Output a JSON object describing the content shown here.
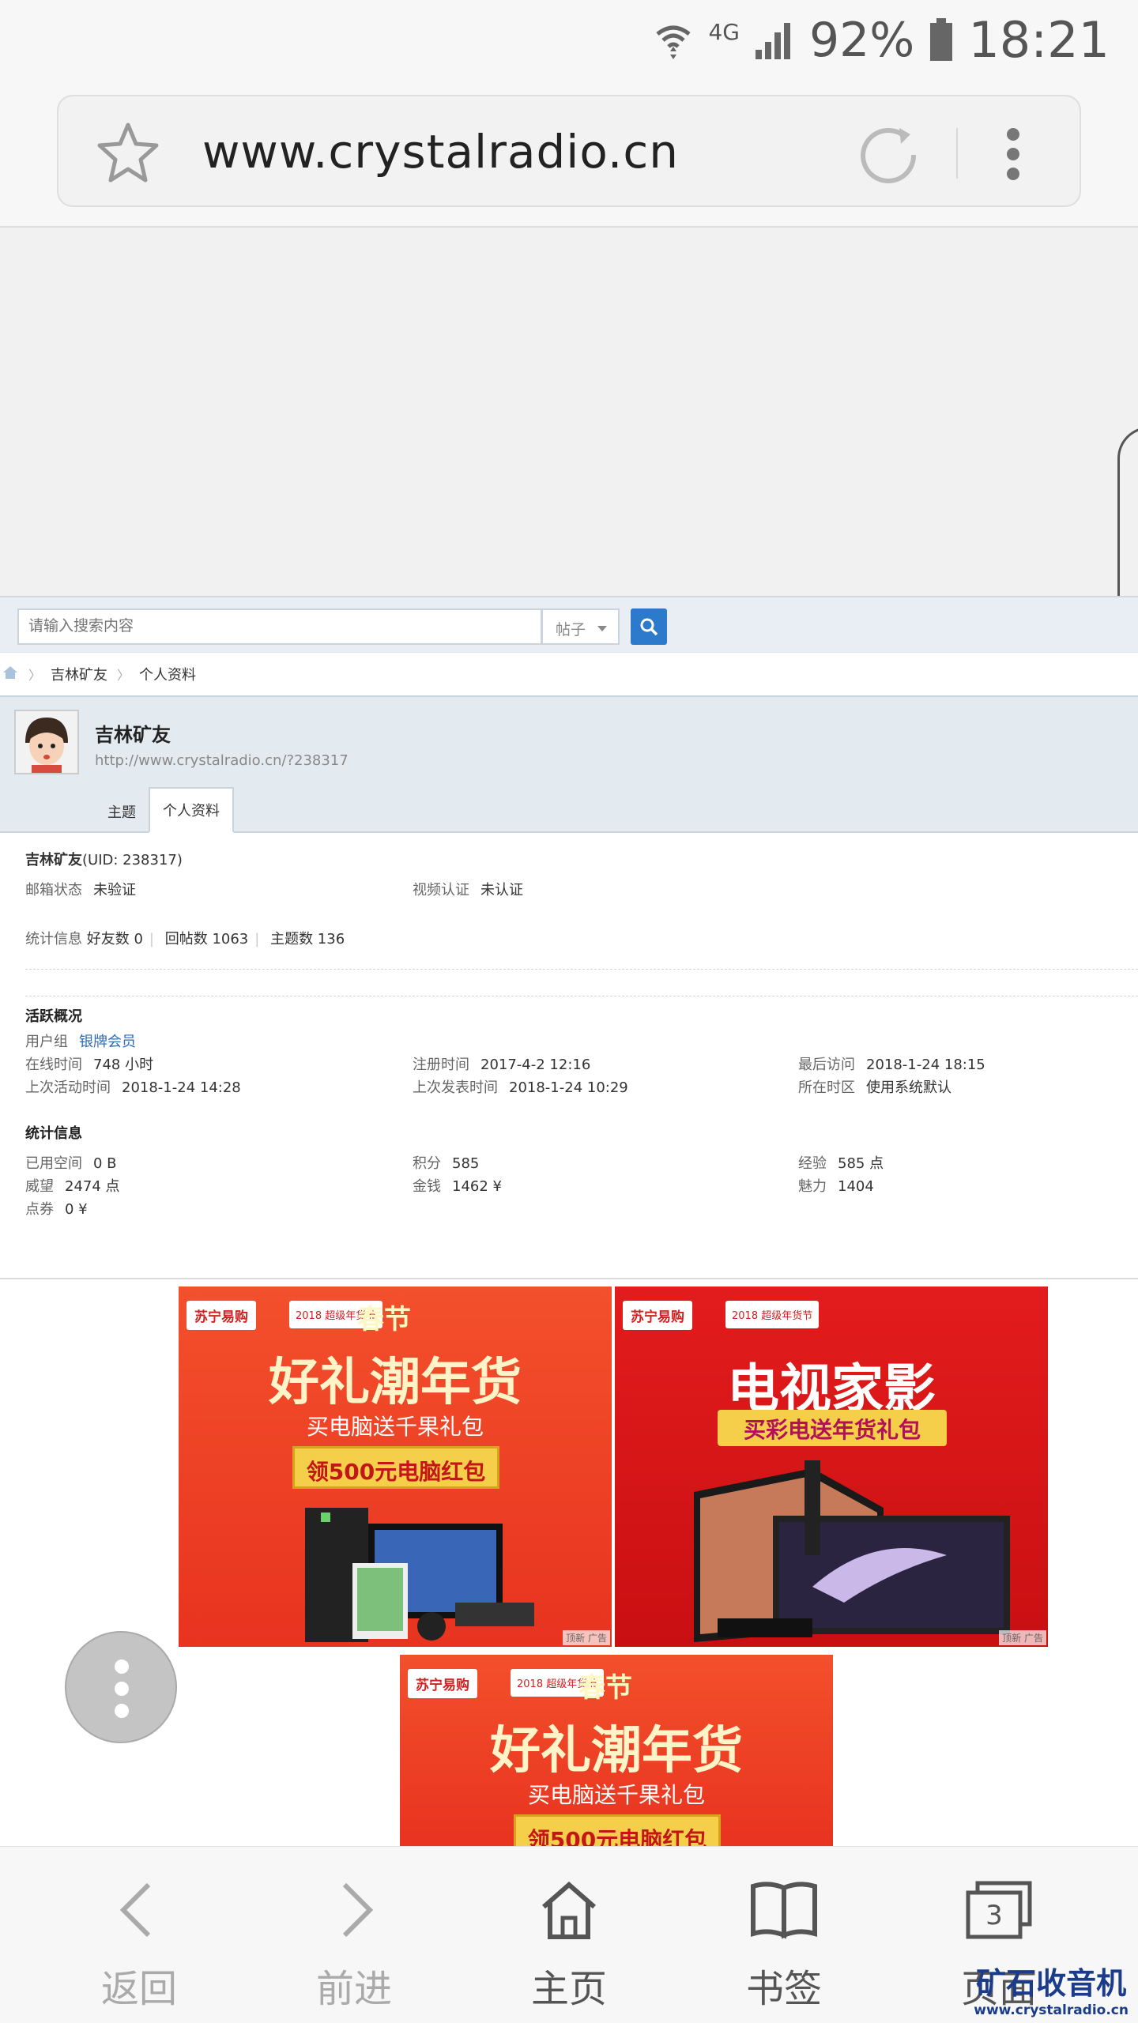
{
  "status_bar": {
    "network": "4G",
    "battery": "92%",
    "time": "18:21"
  },
  "browser": {
    "url": "www.crystalradio.cn"
  },
  "search": {
    "placeholder": "请输入搜索内容",
    "type": "帖子"
  },
  "breadcrumb": {
    "items": [
      "吉林矿友",
      "个人资料"
    ]
  },
  "profile": {
    "name": "吉林矿友",
    "url": "http://www.crystalradio.cn/?238317",
    "tabs": [
      "主题",
      "个人资料"
    ]
  },
  "info": {
    "name": "吉林矿友",
    "uid": "(UID: 238317)",
    "email_label": "邮箱状态",
    "email_value": "未验证",
    "video_label": "视频认证",
    "video_value": "未认证",
    "stats_label": "统计信息",
    "friends": "好友数 0",
    "replies": "回帖数 1063",
    "topics": "主题数 136",
    "activity_title": "活跃概况",
    "group_label": "用户组",
    "group_value": "银牌会员",
    "online_label": "在线时间",
    "online_value": "748 小时",
    "reg_label": "注册时间",
    "reg_value": "2017-4-2 12:16",
    "last_visit_label": "最后访问",
    "last_visit_value": "2018-1-24 18:15",
    "last_active_label": "上次活动时间",
    "last_active_value": "2018-1-24 14:28",
    "last_post_label": "上次发表时间",
    "last_post_value": "2018-1-24 10:29",
    "tz_label": "所在时区",
    "tz_value": "使用系统默认",
    "stat_title": "统计信息",
    "space_label": "已用空间",
    "space_value": "0 B",
    "points_label": "积分",
    "points_value": "585",
    "exp_label": "经验",
    "exp_value": "585 点",
    "prestige_label": "威望",
    "prestige_value": "2474 点",
    "money_label": "金钱",
    "money_value": "1462 ¥",
    "charm_label": "魅力",
    "charm_value": "1404",
    "coupon_label": "点券",
    "coupon_value": "0 ¥"
  },
  "ads": {
    "logo": "苏宁易购",
    "logo2": "2018 超级年货节",
    "tag": "顶新 广告",
    "ad1_top": "春节",
    "ad1_big": "好礼潮年货",
    "ad1_sub": "买电脑送千果礼包",
    "ad1_coupon": "领500元电脑红包",
    "ad2_big": "电视家影",
    "ad2_sub": "买彩电送年货礼包"
  },
  "bottom_nav": {
    "back": "返回",
    "forward": "前进",
    "home": "主页",
    "bookmarks": "书签",
    "pages": "页面",
    "pages_count": "3"
  },
  "watermark": {
    "line1": "矿石收音机",
    "line2": "www.crystalradio.cn"
  },
  "colors": {
    "accent": "#2b7acb",
    "ad_red": "#e8331f",
    "link": "#2a6ab8"
  }
}
